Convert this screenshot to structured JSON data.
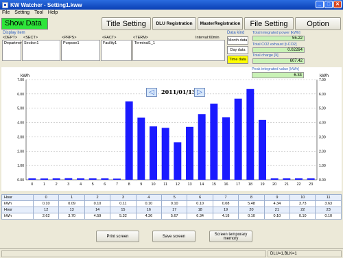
{
  "window": {
    "title": "KW Watcher - Setting1.kww"
  },
  "menu": [
    "File",
    "Setting",
    "Tool",
    "Help"
  ],
  "toolbar": {
    "show_data": "Show Data",
    "title_setting": "Title Setting",
    "dlu_registration": "DLU Registration",
    "master_registration": "MasterRegistration",
    "file_setting": "File Setting",
    "option": "Option"
  },
  "display_item": {
    "label": "Display item",
    "headers": [
      "<DEPT>",
      "<SECT>",
      "<PRPS>",
      "<FACT>",
      "<TERM>"
    ],
    "values": [
      "Department1",
      "Section1",
      "Purpose1",
      "Facility1",
      "Terminal1_1"
    ],
    "interval": "Interval:60min"
  },
  "data_kind": {
    "label": "Data kind",
    "buttons": [
      "Month data",
      "Day data",
      "Time data"
    ],
    "active": "Time data"
  },
  "summary": {
    "total_power_label": "Total integrated power [kWh]",
    "total_power": "55.22",
    "co2_label": "Total CO2 exhaust [t-CO2]",
    "co2": "0.02264",
    "charge_label": "Total charge [¥]",
    "charge": "607.42",
    "peak_label": "Peak integrated value [kWh]",
    "peak": "6.34"
  },
  "nav": {
    "prev": "◁",
    "date": "2011/01/13",
    "next": "▷"
  },
  "table": {
    "row1_label": "Hour",
    "row2_label": "kWh",
    "hours_a": [
      "0",
      "1",
      "2",
      "3",
      "4",
      "5",
      "6",
      "7",
      "8",
      "9",
      "10",
      "11"
    ],
    "values_a": [
      "0.10",
      "0.09",
      "0.10",
      "0.11",
      "0.10",
      "0.10",
      "0.10",
      "0.08",
      "5.48",
      "4.34",
      "3.73",
      "3.63"
    ],
    "hours_b": [
      "12",
      "13",
      "14",
      "15",
      "16",
      "17",
      "18",
      "19",
      "20",
      "21",
      "22",
      "23"
    ],
    "values_b": [
      "2.62",
      "3.70",
      "4.59",
      "5.32",
      "4.36",
      "5.67",
      "6.34",
      "4.18",
      "0.10",
      "0.10",
      "0.10",
      "0.10"
    ]
  },
  "buttons": {
    "print": "Print screen",
    "save": "Save screen",
    "temp": "Screen temporary memory"
  },
  "status": {
    "right": "DLU=1,BLK=1"
  },
  "colors": {
    "bar": "#1a1aff",
    "accent": "#2ee53a",
    "active_kind": "#ffff00"
  },
  "chart_data": {
    "type": "bar",
    "unit_left": "kWh",
    "unit_right": "kWh",
    "categories": [
      "0",
      "1",
      "2",
      "3",
      "4",
      "5",
      "6",
      "7",
      "8",
      "9",
      "10",
      "11",
      "12",
      "13",
      "14",
      "15",
      "16",
      "17",
      "18",
      "19",
      "20",
      "21",
      "22",
      "23"
    ],
    "values": [
      0.1,
      0.09,
      0.1,
      0.11,
      0.1,
      0.1,
      0.1,
      0.08,
      5.48,
      4.34,
      3.73,
      3.63,
      2.62,
      3.7,
      4.59,
      5.32,
      4.36,
      5.67,
      6.34,
      4.18,
      0.1,
      0.1,
      0.1,
      0.1
    ],
    "y_ticks": [
      "0.00",
      "1.00",
      "2.00",
      "3.00",
      "4.00",
      "5.00",
      "6.00",
      "7.00"
    ],
    "ylim": [
      0,
      7
    ],
    "grid": true
  }
}
